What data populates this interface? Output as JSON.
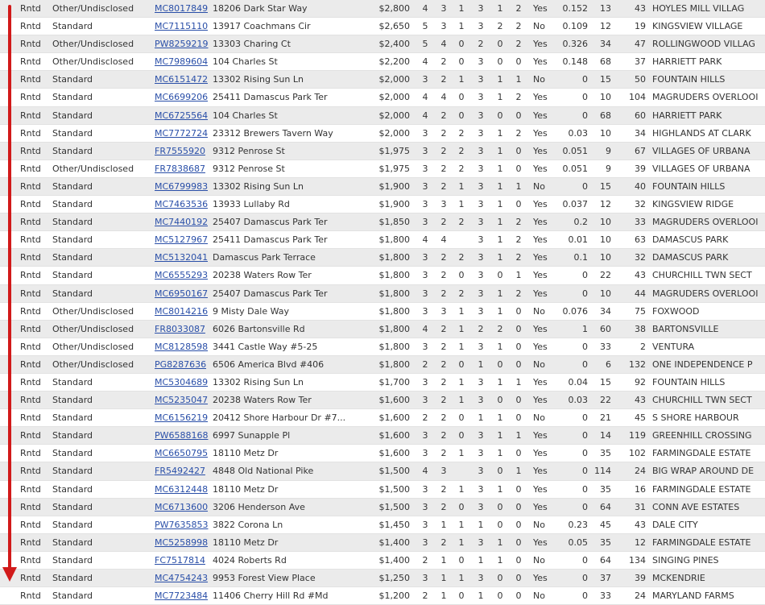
{
  "arrow_color": "#d11a1a",
  "link_color": "#2a4fa8",
  "rows": [
    {
      "status": "Rntd",
      "type": "Other/Undisclosed",
      "mls": "MC8017849",
      "address": "18206 Dark Star Way",
      "price": "$2,800",
      "c1": "4",
      "c2": "3",
      "c3": "1",
      "c4": "3",
      "c5": "1",
      "c6": "2",
      "yesno": "Yes",
      "num": "0.152",
      "dom": "13",
      "total": "43",
      "subdivision": "HOYLES MILL VILLAG"
    },
    {
      "status": "Rntd",
      "type": "Standard",
      "mls": "MC7115110",
      "address": "13917 Coachmans Cir",
      "price": "$2,650",
      "c1": "5",
      "c2": "3",
      "c3": "1",
      "c4": "3",
      "c5": "2",
      "c6": "2",
      "yesno": "No",
      "num": "0.109",
      "dom": "12",
      "total": "19",
      "subdivision": "KINGSVIEW VILLAGE"
    },
    {
      "status": "Rntd",
      "type": "Other/Undisclosed",
      "mls": "PW8259219",
      "address": "13303 Charing Ct",
      "price": "$2,400",
      "c1": "5",
      "c2": "4",
      "c3": "0",
      "c4": "2",
      "c5": "0",
      "c6": "2",
      "yesno": "Yes",
      "num": "0.326",
      "dom": "34",
      "total": "47",
      "subdivision": "ROLLINGWOOD VILLAG"
    },
    {
      "status": "Rntd",
      "type": "Other/Undisclosed",
      "mls": "MC7989604",
      "address": "104 Charles St",
      "price": "$2,200",
      "c1": "4",
      "c2": "2",
      "c3": "0",
      "c4": "3",
      "c5": "0",
      "c6": "0",
      "yesno": "Yes",
      "num": "0.148",
      "dom": "68",
      "total": "37",
      "subdivision": "HARRIETT PARK"
    },
    {
      "status": "Rntd",
      "type": "Standard",
      "mls": "MC6151472",
      "address": "13302 Rising Sun Ln",
      "price": "$2,000",
      "c1": "3",
      "c2": "2",
      "c3": "1",
      "c4": "3",
      "c5": "1",
      "c6": "1",
      "yesno": "No",
      "num": "0",
      "dom": "15",
      "total": "50",
      "subdivision": "FOUNTAIN HILLS"
    },
    {
      "status": "Rntd",
      "type": "Standard",
      "mls": "MC6699206",
      "address": "25411 Damascus Park Ter",
      "price": "$2,000",
      "c1": "4",
      "c2": "4",
      "c3": "0",
      "c4": "3",
      "c5": "1",
      "c6": "2",
      "yesno": "Yes",
      "num": "0",
      "dom": "10",
      "total": "104",
      "subdivision": "MAGRUDERS OVERLOOI"
    },
    {
      "status": "Rntd",
      "type": "Standard",
      "mls": "MC6725564",
      "address": "104 Charles St",
      "price": "$2,000",
      "c1": "4",
      "c2": "2",
      "c3": "0",
      "c4": "3",
      "c5": "0",
      "c6": "0",
      "yesno": "Yes",
      "num": "0",
      "dom": "68",
      "total": "60",
      "subdivision": "HARRIETT PARK"
    },
    {
      "status": "Rntd",
      "type": "Standard",
      "mls": "MC7772724",
      "address": "23312 Brewers Tavern Way",
      "price": "$2,000",
      "c1": "3",
      "c2": "2",
      "c3": "2",
      "c4": "3",
      "c5": "1",
      "c6": "2",
      "yesno": "Yes",
      "num": "0.03",
      "dom": "10",
      "total": "34",
      "subdivision": "HIGHLANDS AT CLARK"
    },
    {
      "status": "Rntd",
      "type": "Standard",
      "mls": "FR7555920",
      "address": "9312 Penrose St",
      "price": "$1,975",
      "c1": "3",
      "c2": "2",
      "c3": "2",
      "c4": "3",
      "c5": "1",
      "c6": "0",
      "yesno": "Yes",
      "num": "0.051",
      "dom": "9",
      "total": "67",
      "subdivision": "VILLAGES OF URBANA"
    },
    {
      "status": "Rntd",
      "type": "Other/Undisclosed",
      "mls": "FR7838687",
      "address": "9312 Penrose St",
      "price": "$1,975",
      "c1": "3",
      "c2": "2",
      "c3": "2",
      "c4": "3",
      "c5": "1",
      "c6": "0",
      "yesno": "Yes",
      "num": "0.051",
      "dom": "9",
      "total": "39",
      "subdivision": "VILLAGES OF URBANA"
    },
    {
      "status": "Rntd",
      "type": "Standard",
      "mls": "MC6799983",
      "address": "13302 Rising Sun Ln",
      "price": "$1,900",
      "c1": "3",
      "c2": "2",
      "c3": "1",
      "c4": "3",
      "c5": "1",
      "c6": "1",
      "yesno": "No",
      "num": "0",
      "dom": "15",
      "total": "40",
      "subdivision": "FOUNTAIN HILLS"
    },
    {
      "status": "Rntd",
      "type": "Standard",
      "mls": "MC7463536",
      "address": "13933 Lullaby Rd",
      "price": "$1,900",
      "c1": "3",
      "c2": "3",
      "c3": "1",
      "c4": "3",
      "c5": "1",
      "c6": "0",
      "yesno": "Yes",
      "num": "0.037",
      "dom": "12",
      "total": "32",
      "subdivision": "KINGSVIEW RIDGE"
    },
    {
      "status": "Rntd",
      "type": "Standard",
      "mls": "MC7440192",
      "address": "25407 Damascus Park Ter",
      "price": "$1,850",
      "c1": "3",
      "c2": "2",
      "c3": "2",
      "c4": "3",
      "c5": "1",
      "c6": "2",
      "yesno": "Yes",
      "num": "0.2",
      "dom": "10",
      "total": "33",
      "subdivision": "MAGRUDERS OVERLOOI"
    },
    {
      "status": "Rntd",
      "type": "Standard",
      "mls": "MC5127967",
      "address": "25411 Damascus Park Ter",
      "price": "$1,800",
      "c1": "4",
      "c2": "4",
      "c3": "",
      "c4": "3",
      "c5": "1",
      "c6": "2",
      "yesno": "Yes",
      "num": "0.01",
      "dom": "10",
      "total": "63",
      "subdivision": "DAMASCUS PARK"
    },
    {
      "status": "Rntd",
      "type": "Standard",
      "mls": "MC5132041",
      "address": "Damascus Park Terrace",
      "price": "$1,800",
      "c1": "3",
      "c2": "2",
      "c3": "2",
      "c4": "3",
      "c5": "1",
      "c6": "2",
      "yesno": "Yes",
      "num": "0.1",
      "dom": "10",
      "total": "32",
      "subdivision": "DAMASCUS PARK"
    },
    {
      "status": "Rntd",
      "type": "Standard",
      "mls": "MC6555293",
      "address": "20238 Waters Row Ter",
      "price": "$1,800",
      "c1": "3",
      "c2": "2",
      "c3": "0",
      "c4": "3",
      "c5": "0",
      "c6": "1",
      "yesno": "Yes",
      "num": "0",
      "dom": "22",
      "total": "43",
      "subdivision": "CHURCHILL TWN SECT"
    },
    {
      "status": "Rntd",
      "type": "Standard",
      "mls": "MC6950167",
      "address": "25407 Damascus Park Ter",
      "price": "$1,800",
      "c1": "3",
      "c2": "2",
      "c3": "2",
      "c4": "3",
      "c5": "1",
      "c6": "2",
      "yesno": "Yes",
      "num": "0",
      "dom": "10",
      "total": "44",
      "subdivision": "MAGRUDERS OVERLOOI"
    },
    {
      "status": "Rntd",
      "type": "Other/Undisclosed",
      "mls": "MC8014216",
      "address": "9 Misty Dale Way",
      "price": "$1,800",
      "c1": "3",
      "c2": "3",
      "c3": "1",
      "c4": "3",
      "c5": "1",
      "c6": "0",
      "yesno": "No",
      "num": "0.076",
      "dom": "34",
      "total": "75",
      "subdivision": "FOXWOOD"
    },
    {
      "status": "Rntd",
      "type": "Other/Undisclosed",
      "mls": "FR8033087",
      "address": "6026 Bartonsville Rd",
      "price": "$1,800",
      "c1": "4",
      "c2": "2",
      "c3": "1",
      "c4": "2",
      "c5": "2",
      "c6": "0",
      "yesno": "Yes",
      "num": "1",
      "dom": "60",
      "total": "38",
      "subdivision": "BARTONSVILLE"
    },
    {
      "status": "Rntd",
      "type": "Other/Undisclosed",
      "mls": "MC8128598",
      "address": "3441 Castle Way #5-25",
      "price": "$1,800",
      "c1": "3",
      "c2": "2",
      "c3": "1",
      "c4": "3",
      "c5": "1",
      "c6": "0",
      "yesno": "Yes",
      "num": "0",
      "dom": "33",
      "total": "2",
      "subdivision": "VENTURA"
    },
    {
      "status": "Rntd",
      "type": "Other/Undisclosed",
      "mls": "PG8287636",
      "address": "6506 America Blvd #406",
      "price": "$1,800",
      "c1": "2",
      "c2": "2",
      "c3": "0",
      "c4": "1",
      "c5": "0",
      "c6": "0",
      "yesno": "No",
      "num": "0",
      "dom": "6",
      "total": "132",
      "subdivision": "ONE INDEPENDENCE P"
    },
    {
      "status": "Rntd",
      "type": "Standard",
      "mls": "MC5304689",
      "address": "13302 Rising Sun Ln",
      "price": "$1,700",
      "c1": "3",
      "c2": "2",
      "c3": "1",
      "c4": "3",
      "c5": "1",
      "c6": "1",
      "yesno": "Yes",
      "num": "0.04",
      "dom": "15",
      "total": "92",
      "subdivision": "FOUNTAIN HILLS"
    },
    {
      "status": "Rntd",
      "type": "Standard",
      "mls": "MC5235047",
      "address": "20238 Waters Row Ter",
      "price": "$1,600",
      "c1": "3",
      "c2": "2",
      "c3": "1",
      "c4": "3",
      "c5": "0",
      "c6": "0",
      "yesno": "Yes",
      "num": "0.03",
      "dom": "22",
      "total": "43",
      "subdivision": "CHURCHILL TWN SECT"
    },
    {
      "status": "Rntd",
      "type": "Standard",
      "mls": "MC6156219",
      "address": "20412 Shore Harbour Dr #7...",
      "price": "$1,600",
      "c1": "2",
      "c2": "2",
      "c3": "0",
      "c4": "1",
      "c5": "1",
      "c6": "0",
      "yesno": "No",
      "num": "0",
      "dom": "21",
      "total": "45",
      "subdivision": "S SHORE HARBOUR"
    },
    {
      "status": "Rntd",
      "type": "Standard",
      "mls": "PW6588168",
      "address": "6997 Sunapple Pl",
      "price": "$1,600",
      "c1": "3",
      "c2": "2",
      "c3": "0",
      "c4": "3",
      "c5": "1",
      "c6": "1",
      "yesno": "Yes",
      "num": "0",
      "dom": "14",
      "total": "119",
      "subdivision": "GREENHILL CROSSING"
    },
    {
      "status": "Rntd",
      "type": "Standard",
      "mls": "MC6650795",
      "address": "18110 Metz Dr",
      "price": "$1,600",
      "c1": "3",
      "c2": "2",
      "c3": "1",
      "c4": "3",
      "c5": "1",
      "c6": "0",
      "yesno": "Yes",
      "num": "0",
      "dom": "35",
      "total": "102",
      "subdivision": "FARMINGDALE ESTATE"
    },
    {
      "status": "Rntd",
      "type": "Standard",
      "mls": "FR5492427",
      "address": "4848 Old National Pike",
      "price": "$1,500",
      "c1": "4",
      "c2": "3",
      "c3": "",
      "c4": "3",
      "c5": "0",
      "c6": "1",
      "yesno": "Yes",
      "num": "0",
      "dom": "114",
      "total": "24",
      "subdivision": "BIG WRAP AROUND DE"
    },
    {
      "status": "Rntd",
      "type": "Standard",
      "mls": "MC6312448",
      "address": "18110 Metz Dr",
      "price": "$1,500",
      "c1": "3",
      "c2": "2",
      "c3": "1",
      "c4": "3",
      "c5": "1",
      "c6": "0",
      "yesno": "Yes",
      "num": "0",
      "dom": "35",
      "total": "16",
      "subdivision": "FARMINGDALE ESTATE"
    },
    {
      "status": "Rntd",
      "type": "Standard",
      "mls": "MC6713600",
      "address": "3206 Henderson Ave",
      "price": "$1,500",
      "c1": "3",
      "c2": "2",
      "c3": "0",
      "c4": "3",
      "c5": "0",
      "c6": "0",
      "yesno": "Yes",
      "num": "0",
      "dom": "64",
      "total": "31",
      "subdivision": "CONN AVE ESTATES"
    },
    {
      "status": "Rntd",
      "type": "Standard",
      "mls": "PW7635853",
      "address": "3822 Corona Ln",
      "price": "$1,450",
      "c1": "3",
      "c2": "1",
      "c3": "1",
      "c4": "1",
      "c5": "0",
      "c6": "0",
      "yesno": "No",
      "num": "0.23",
      "dom": "45",
      "total": "43",
      "subdivision": "DALE CITY"
    },
    {
      "status": "Rntd",
      "type": "Standard",
      "mls": "MC5258998",
      "address": "18110 Metz Dr",
      "price": "$1,400",
      "c1": "3",
      "c2": "2",
      "c3": "1",
      "c4": "3",
      "c5": "1",
      "c6": "0",
      "yesno": "Yes",
      "num": "0.05",
      "dom": "35",
      "total": "12",
      "subdivision": "FARMINGDALE ESTATE"
    },
    {
      "status": "Rntd",
      "type": "Standard",
      "mls": "FC7517814",
      "address": "4024 Roberts Rd",
      "price": "$1,400",
      "c1": "2",
      "c2": "1",
      "c3": "0",
      "c4": "1",
      "c5": "1",
      "c6": "0",
      "yesno": "No",
      "num": "0",
      "dom": "64",
      "total": "134",
      "subdivision": "SINGING PINES"
    },
    {
      "status": "Rntd",
      "type": "Standard",
      "mls": "MC4754243",
      "address": "9953 Forest View Place",
      "price": "$1,250",
      "c1": "3",
      "c2": "1",
      "c3": "1",
      "c4": "3",
      "c5": "0",
      "c6": "0",
      "yesno": "Yes",
      "num": "0",
      "dom": "37",
      "total": "39",
      "subdivision": "MCKENDRIE"
    },
    {
      "status": "Rntd",
      "type": "Standard",
      "mls": "MC7723484",
      "address": "11406 Cherry Hill Rd #Md",
      "price": "$1,200",
      "c1": "2",
      "c2": "1",
      "c3": "0",
      "c4": "1",
      "c5": "0",
      "c6": "0",
      "yesno": "No",
      "num": "0",
      "dom": "33",
      "total": "24",
      "subdivision": "MARYLAND FARMS"
    }
  ]
}
